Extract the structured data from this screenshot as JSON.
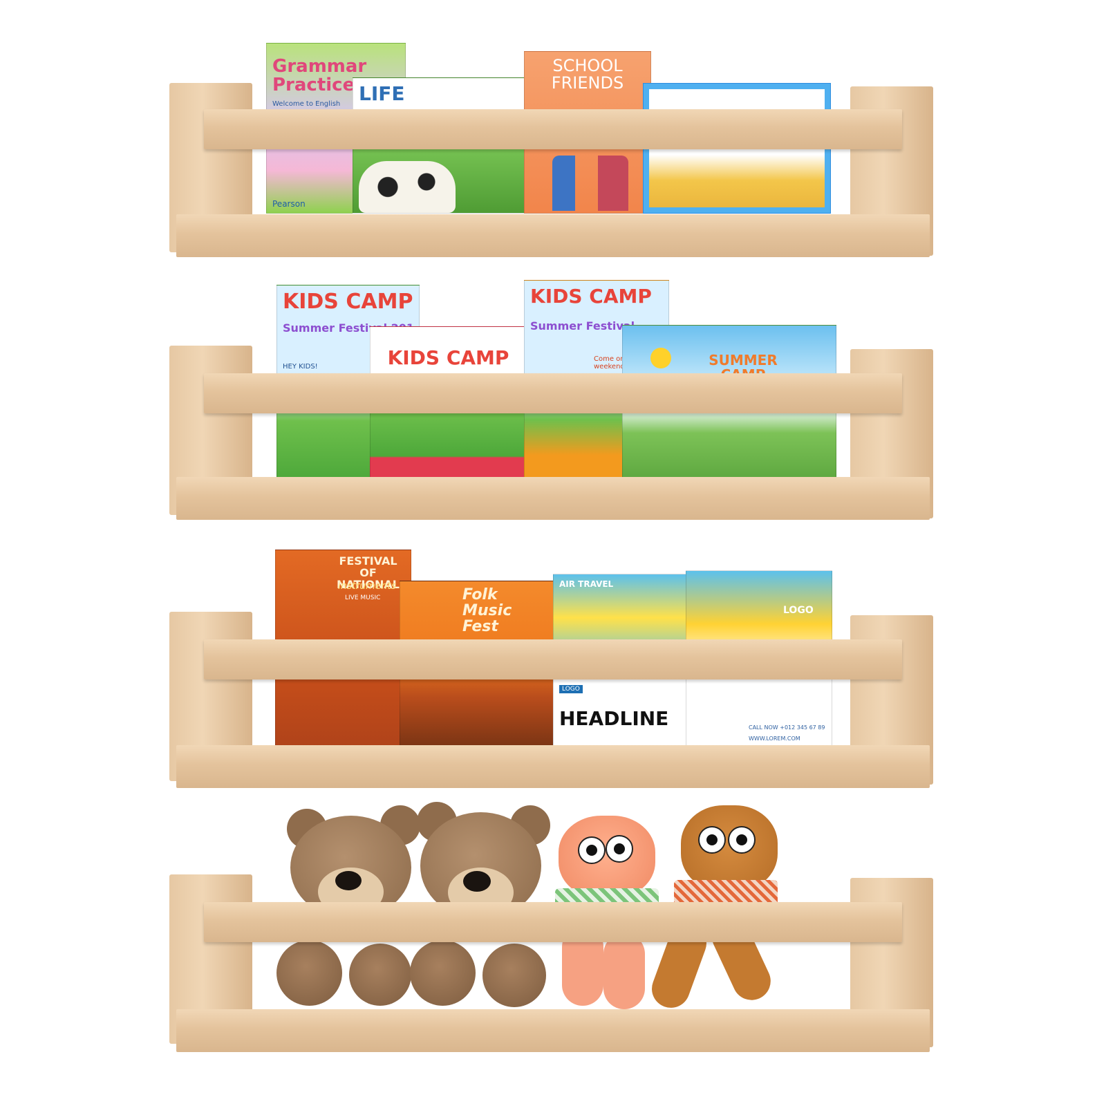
{
  "shelves": [
    {
      "books": [
        {
          "title": "Grammar Practice",
          "subtitle": "Welcome to English",
          "publisher": "Pearson",
          "color": "#8fd14f"
        },
        {
          "title": "LIFE",
          "color": "#5aa83a"
        },
        {
          "title": "SCHOOL FRIENDS",
          "color": "#f4884c"
        },
        {
          "title": "",
          "color": "#3aa7e8"
        }
      ]
    },
    {
      "books": [
        {
          "title": "KIDS CAMP",
          "subtitle": "Summer Festival 201",
          "note": "HEY KIDS!",
          "color": "#1b9fe0"
        },
        {
          "title": "KIDS CAMP",
          "subtitle": "",
          "color": "#e23b4f"
        },
        {
          "title": "KIDS CAMP",
          "subtitle": "Summer Festival",
          "note": "Come on a great weekend",
          "color": "#f39a1e"
        },
        {
          "title": "SUMMER CAMP",
          "color": "#6cc0ef"
        }
      ]
    },
    {
      "books": [
        {
          "title": "FESTIVAL OF NATIONAL",
          "subtitle": "instruments",
          "note": "LIVE MUSIC",
          "color": "#e0661f"
        },
        {
          "title": "Folk Music Fest",
          "color": "#f07a22"
        },
        {
          "title": "AIR TRAVEL",
          "headline": "HEADLINE",
          "logo": "LOGO",
          "color": "#3bb0e3"
        },
        {
          "title": "LOGO",
          "phone": "CALL NOW +012 345 67 89",
          "web": "WWW.LOREM.COM",
          "color": "#2d8fc7"
        }
      ]
    }
  ],
  "toys": [
    {
      "icon": "teddy-bear-icon",
      "color": "#9b7654"
    },
    {
      "icon": "teddy-bear-icon",
      "color": "#9b7654"
    },
    {
      "icon": "cat-toy-icon",
      "color": "#f49a73"
    },
    {
      "icon": "cat-toy-icon",
      "color": "#c67a2e"
    }
  ],
  "colors": {
    "wood": "#e6c7a0",
    "background": "#ffffff"
  }
}
